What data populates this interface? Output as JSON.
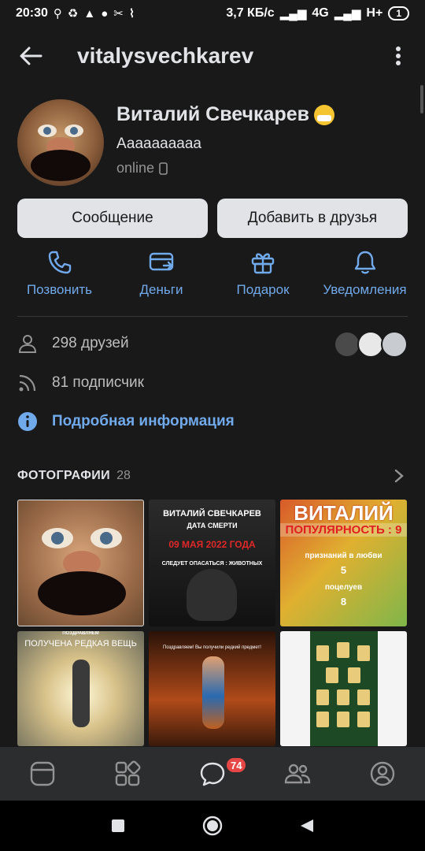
{
  "status_bar": {
    "time": "20:30",
    "speed": "3,7 КБ/с",
    "network": "4G",
    "network2": "H+",
    "battery": "1"
  },
  "header": {
    "title": "vitalysvechkarev"
  },
  "profile": {
    "name": "Виталий Свечкарев",
    "status": "Аааааааааа",
    "online": "online"
  },
  "buttons": {
    "message": "Сообщение",
    "add_friend": "Добавить в друзья"
  },
  "actions": [
    {
      "label": "Позвонить",
      "icon": "phone-icon"
    },
    {
      "label": "Деньги",
      "icon": "money-transfer-icon"
    },
    {
      "label": "Подарок",
      "icon": "gift-icon"
    },
    {
      "label": "Уведомления",
      "icon": "bell-icon"
    }
  ],
  "info": {
    "friends": "298 друзей",
    "followers": "81 подписчик",
    "details": "Подробная информация"
  },
  "photos": {
    "title": "ФОТОГРАФИИ",
    "count": "28",
    "p2": {
      "line1": "ВИТАЛИЙ СВЕЧКАРЕВ",
      "line2": "ДАТА СМЕРТИ",
      "line3": "09 МАЯ 2022 ГОДА",
      "line4": "СЛЕДУЕТ ОПАСАТЬСЯ : ЖИВОТНЫХ"
    },
    "p3": {
      "line1": "ВИТАЛИЙ",
      "line2": "ПОПУЛЯРНОСТЬ : 9",
      "line3": "признаний в любви",
      "line4": "5",
      "line5": "поцелуев",
      "line6": "8"
    },
    "p4": {
      "line1": "ПОЗДРАВЛЯЕМ",
      "line2": "ПОЛУЧЕНА РЕДКАЯ ВЕЩЬ"
    },
    "p5": {
      "line1": "Поздравляем! Вы получили редкий предмет!"
    }
  },
  "tab_bar": {
    "messages_badge": "74"
  },
  "colors": {
    "background": "#19191a",
    "accent": "#71aaeb",
    "button_bg": "#e1e3e6",
    "tab_bar": "#2c2d2e",
    "badge": "#e64646"
  }
}
